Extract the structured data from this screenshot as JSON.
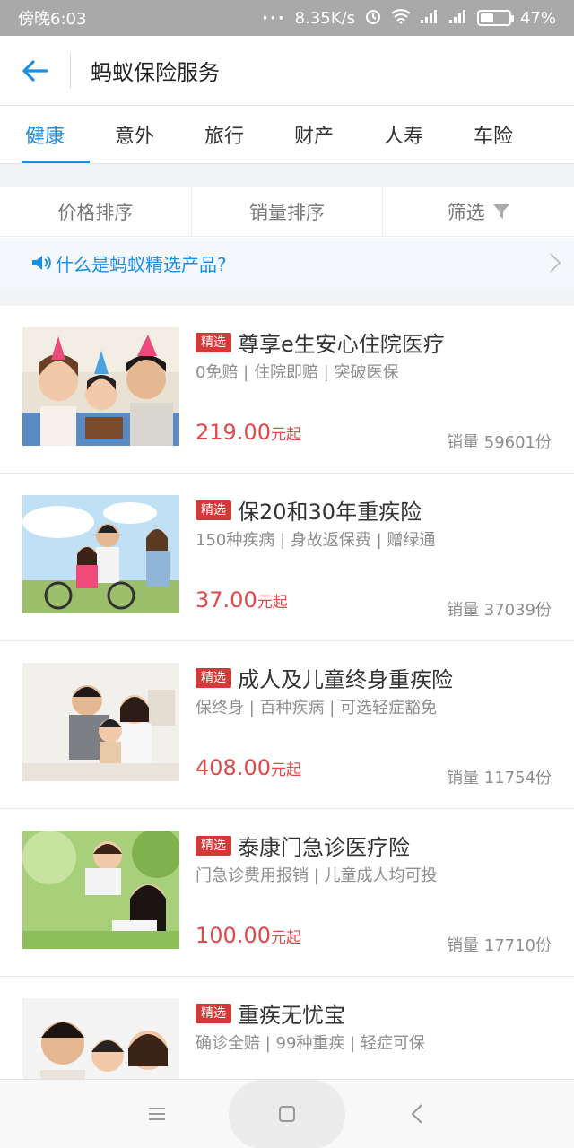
{
  "status_bar": {
    "time": "傍晚6:03",
    "net_speed": "8.35K/s",
    "battery": "47%",
    "battery_level": 0.47,
    "icons": [
      "dots-icon",
      "alarm-icon",
      "wifi-icon",
      "signal-icon",
      "signal-icon",
      "battery-icon"
    ]
  },
  "header": {
    "title": "蚂蚁保险服务",
    "back_icon": "arrow-left-icon"
  },
  "tabs": [
    {
      "label": "健康",
      "active": true
    },
    {
      "label": "意外",
      "active": false
    },
    {
      "label": "旅行",
      "active": false
    },
    {
      "label": "财产",
      "active": false
    },
    {
      "label": "人寿",
      "active": false
    },
    {
      "label": "车险",
      "active": false
    }
  ],
  "sort": {
    "price": "价格排序",
    "sales": "销量排序",
    "filter": "筛选",
    "filter_icon": "funnel-icon"
  },
  "notice": {
    "text": "什么是蚂蚁精选产品?",
    "icon": "speaker-icon"
  },
  "products": [
    {
      "badge": "精选",
      "name": "尊享e生安心住院医疗",
      "tags": "0免赔 | 住院即赔 | 突破医保",
      "price": "219.00",
      "price_unit": "元起",
      "sales": "销量 59601份",
      "image": "family-birthday-photo"
    },
    {
      "badge": "精选",
      "name": "保20和30年重疾险",
      "tags": "150种疾病 | 身故返保费 | 赠绿通",
      "price": "37.00",
      "price_unit": "元起",
      "sales": "销量 37039份",
      "image": "family-bicycle-photo"
    },
    {
      "badge": "精选",
      "name": "成人及儿童终身重疾险",
      "tags": "保终身 | 百种疾病 | 可选轻症豁免",
      "price": "408.00",
      "price_unit": "元起",
      "sales": "销量 11754份",
      "image": "family-sofa-photo"
    },
    {
      "badge": "精选",
      "name": "泰康门急诊医疗险",
      "tags": "门急诊费用报销 | 儿童成人均可投",
      "price": "100.00",
      "price_unit": "元起",
      "sales": "销量 17710份",
      "image": "mother-baby-photo"
    },
    {
      "badge": "精选",
      "name": "重疾无忧宝",
      "tags": "确诊全赔 | 99种重疾 | 轻症可保",
      "price": "",
      "price_unit": "",
      "sales": "",
      "image": "family-portrait-photo"
    }
  ],
  "colors": {
    "accent": "#1a8fe6",
    "price": "#e0484a",
    "badge": "#d23a3a",
    "status_bar": "#a9a9a9"
  },
  "nav": {
    "menu_icon": "menu-icon",
    "home_icon": "square-home-icon",
    "back_icon": "chevron-left-icon"
  }
}
